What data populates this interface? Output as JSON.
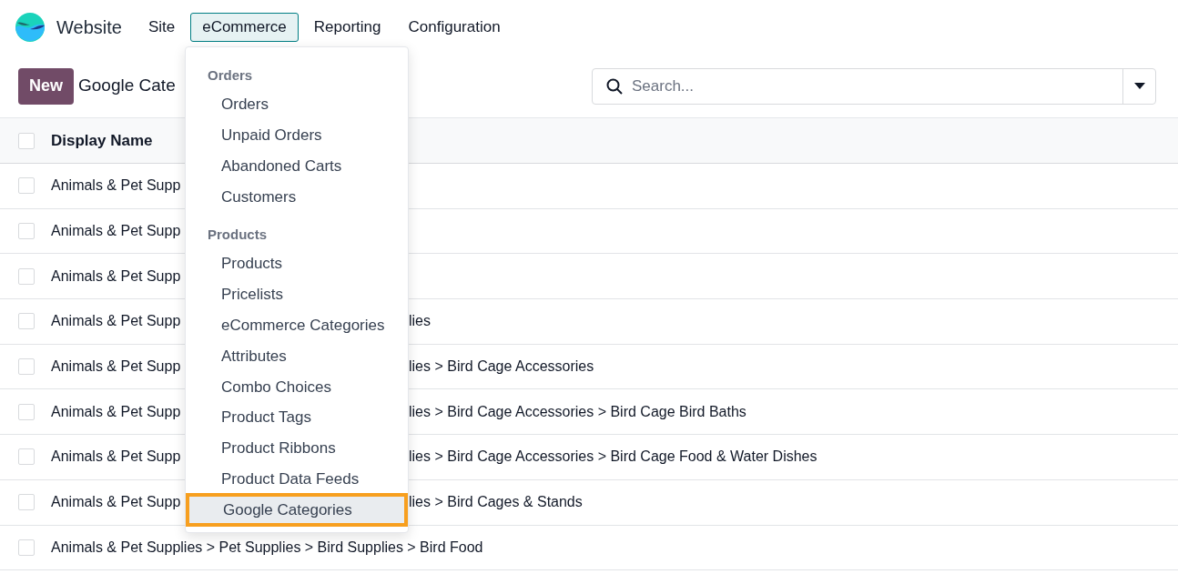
{
  "app": {
    "name": "Website"
  },
  "nav": [
    {
      "label": "Site",
      "selected": false
    },
    {
      "label": "eCommerce",
      "selected": true
    },
    {
      "label": "Reporting",
      "selected": false
    },
    {
      "label": "Configuration",
      "selected": false
    }
  ],
  "new_button": "New",
  "page_title": "Google Cate",
  "search": {
    "placeholder": "Search..."
  },
  "table": {
    "columns": [
      "Display Name"
    ],
    "header_checked": false,
    "rows": [
      {
        "checked": false,
        "left": "Animals & Pet Supp"
      },
      {
        "checked": false,
        "left": "Animals & Pet Supp"
      },
      {
        "checked": false,
        "left": "Animals & Pet Supp"
      },
      {
        "checked": false,
        "left": "Animals & Pet Supp",
        "right": "lies"
      },
      {
        "checked": false,
        "left": "Animals & Pet Supp",
        "right": "lies > Bird Cage Accessories"
      },
      {
        "checked": false,
        "left": "Animals & Pet Supp",
        "right": "lies > Bird Cage Accessories > Bird Cage Bird Baths"
      },
      {
        "checked": false,
        "left": "Animals & Pet Supp",
        "right": "lies > Bird Cage Accessories > Bird Cage Food & Water Dishes"
      },
      {
        "checked": false,
        "left": "Animals & Pet Supp",
        "right": "lies > Bird Cages & Stands"
      },
      {
        "checked": false,
        "left": "Animals & Pet Supplies > Pet Supplies > Bird Supplies > Bird Food"
      }
    ]
  },
  "menu": {
    "sections": [
      {
        "title": "Orders",
        "items": [
          {
            "label": "Orders",
            "selected": false
          },
          {
            "label": "Unpaid Orders",
            "selected": false
          },
          {
            "label": "Abandoned Carts",
            "selected": false
          },
          {
            "label": "Customers",
            "selected": false
          }
        ]
      },
      {
        "title": "Products",
        "items": [
          {
            "label": "Products",
            "selected": false
          },
          {
            "label": "Pricelists",
            "selected": false
          },
          {
            "label": "eCommerce Categories",
            "selected": false
          },
          {
            "label": "Attributes",
            "selected": false
          },
          {
            "label": "Combo Choices",
            "selected": false
          },
          {
            "label": "Product Tags",
            "selected": false
          },
          {
            "label": "Product Ribbons",
            "selected": false
          },
          {
            "label": "Product Data Feeds",
            "selected": false
          },
          {
            "label": "Google Categories",
            "selected": true
          }
        ]
      }
    ]
  }
}
